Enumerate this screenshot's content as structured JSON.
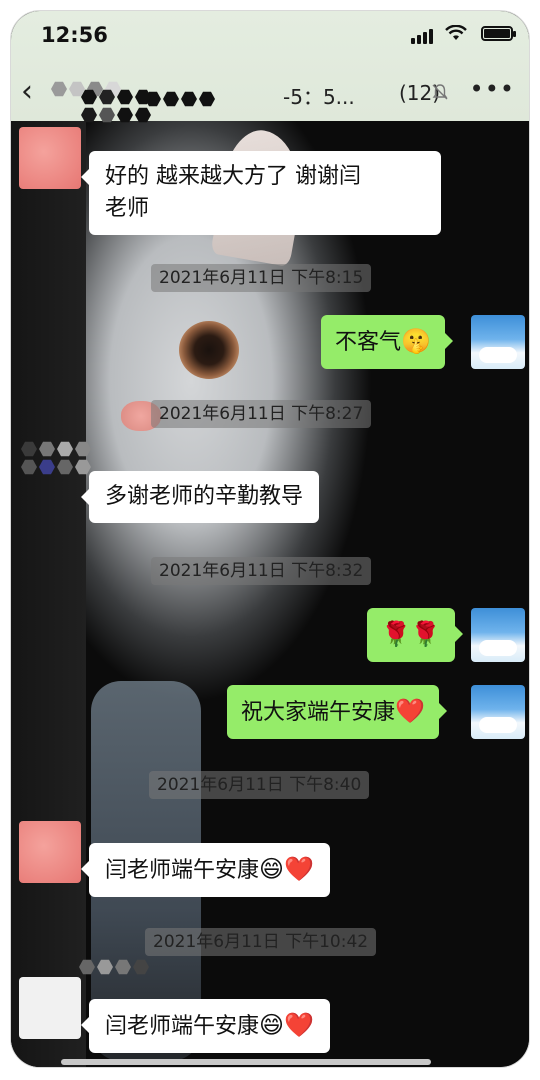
{
  "status_bar": {
    "time": "12:56"
  },
  "header": {
    "title": "-5：5...",
    "member_count": "(12)",
    "back_icon": "chevron-left-icon",
    "mute_icon": "bell-off-icon",
    "more_icon": "ellipsis-icon"
  },
  "messages": [
    {
      "type": "in",
      "text_line1": "好的    越来越大方了 谢谢闫",
      "text_line2": "老师"
    },
    {
      "type": "timestamp",
      "text": "2021年6月11日 下午8:15"
    },
    {
      "type": "out",
      "text": "不客气",
      "emoji": "🤫"
    },
    {
      "type": "timestamp",
      "text": "2021年6月11日 下午8:27"
    },
    {
      "type": "in",
      "text": "多谢老师的辛勤教导"
    },
    {
      "type": "timestamp",
      "text": "2021年6月11日 下午8:32"
    },
    {
      "type": "out",
      "text": "🌹🌹"
    },
    {
      "type": "out",
      "text": "祝大家端午安康",
      "emoji": "❤️"
    },
    {
      "type": "timestamp",
      "text": "2021年6月11日 下午8:40"
    },
    {
      "type": "in",
      "text": "闫老师端午安康",
      "emoji": "😄❤️"
    },
    {
      "type": "timestamp",
      "text": "2021年6月11日 下午10:42"
    },
    {
      "type": "in",
      "text": "闫老师端午安康",
      "emoji": "😄❤️"
    }
  ],
  "colors": {
    "out_bubble": "#95ec69",
    "in_bubble": "#ffffff",
    "header_bg": "#dfe8da"
  }
}
